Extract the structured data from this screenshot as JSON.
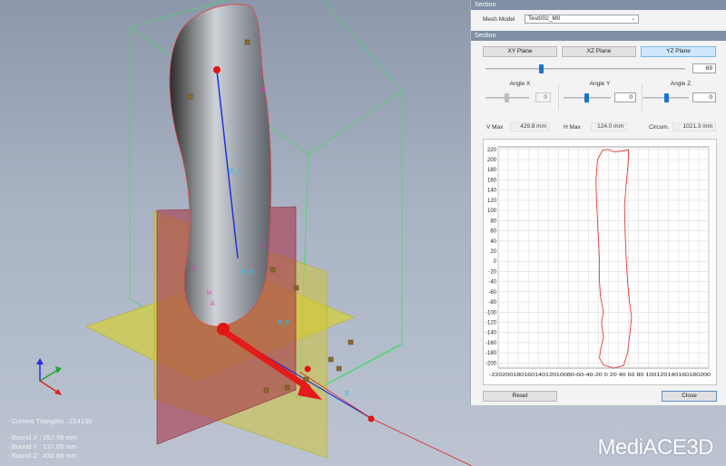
{
  "panel": {
    "section_header": "Section",
    "mesh_model_label": "Mesh Model",
    "mesh_model_value": "Test002_M0",
    "section2_header": "Section",
    "planes": [
      "XY Plane",
      "XZ Plane",
      "YZ Plane"
    ],
    "active_plane": "YZ Plane",
    "position_value": "69",
    "position_fraction": 0.27,
    "angle_x_label": "Angle X",
    "angle_x_value": "0",
    "angle_y_label": "Angle Y",
    "angle_y_value": "0",
    "angle_z_label": "Angle Z",
    "angle_z_value": "0",
    "vmax_label": "V Max",
    "vmax_value": "429.8 mm",
    "hmax_label": "H Max",
    "hmax_value": "124.0 mm",
    "circum_label": "Circum.",
    "circum_value": "1021.3 mm",
    "reset_label": "Reset",
    "close_label": "Close"
  },
  "viewport": {
    "current_triangles": "- Current Triangles : 214136",
    "bound_x": "- Bound X : 257.55 mm",
    "bound_y": "- Bound Y : 137.05 mm",
    "bound_z": "- Bound Z : 432.88 mm",
    "logo": "MediACE3D",
    "marker_labels": [
      "B_T",
      "B_S",
      "B_P",
      "H",
      "A",
      "M",
      "B",
      "K",
      "B"
    ]
  },
  "chart_data": {
    "type": "line",
    "x_ticks": [
      -220,
      -200,
      -180,
      -160,
      -140,
      -120,
      -100,
      -80,
      -60,
      -40,
      -20,
      0,
      20,
      40,
      60,
      80,
      100,
      120,
      140,
      160,
      180,
      200
    ],
    "y_ticks": [
      220,
      200,
      180,
      160,
      140,
      120,
      100,
      80,
      60,
      40,
      20,
      0,
      -20,
      -40,
      -60,
      -80,
      -100,
      -120,
      -140,
      -160,
      -180,
      -200
    ],
    "xlim": [
      -220,
      200
    ],
    "ylim": [
      -210,
      225
    ],
    "grid": true,
    "color": "#e23b3b",
    "x_tick_text": "-22020018016014012010080-60-40-20 0 20 40 60 80 100120140160180200",
    "outline": [
      [
        -12,
        218
      ],
      [
        -2,
        220
      ],
      [
        12,
        215
      ],
      [
        28,
        217
      ],
      [
        40,
        219
      ],
      [
        39,
        190
      ],
      [
        35,
        150
      ],
      [
        32,
        110
      ],
      [
        33,
        60
      ],
      [
        35,
        10
      ],
      [
        38,
        -40
      ],
      [
        42,
        -80
      ],
      [
        46,
        -110
      ],
      [
        43,
        -140
      ],
      [
        38,
        -180
      ],
      [
        30,
        -205
      ],
      [
        10,
        -210
      ],
      [
        -10,
        -204
      ],
      [
        -18,
        -190
      ],
      [
        -15,
        -170
      ],
      [
        -10,
        -150
      ],
      [
        -14,
        -120
      ],
      [
        -10,
        -100
      ],
      [
        -16,
        -70
      ],
      [
        -18,
        -40
      ],
      [
        -18,
        0
      ],
      [
        -20,
        40
      ],
      [
        -22,
        80
      ],
      [
        -24,
        120
      ],
      [
        -25,
        160
      ],
      [
        -22,
        200
      ],
      [
        -12,
        218
      ]
    ]
  }
}
